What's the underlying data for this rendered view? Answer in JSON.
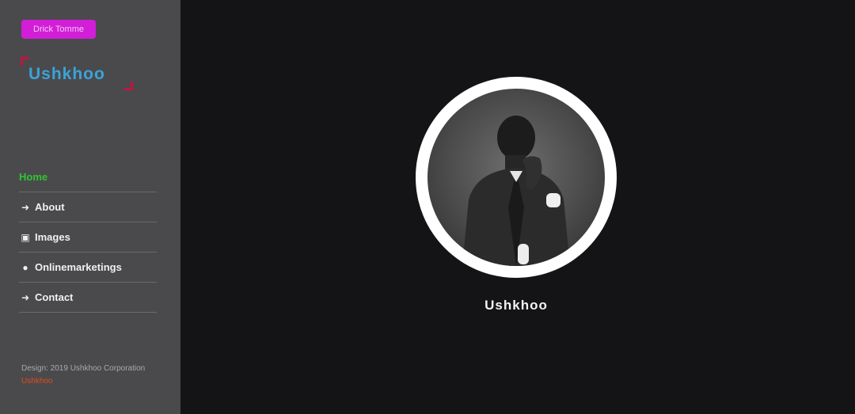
{
  "sidebar": {
    "badge_label": "Drick Tomme",
    "logo_text": "Ushkhoo",
    "nav_items": [
      {
        "label": "Home",
        "icon": "home-icon",
        "glyph": "",
        "active": true
      },
      {
        "label": "About",
        "icon": "arrow-right-icon",
        "glyph": "➜",
        "active": false
      },
      {
        "label": "Images",
        "icon": "image-icon",
        "glyph": "▣",
        "active": false
      },
      {
        "label": "Onlinemarketings",
        "icon": "chat-bubble-icon",
        "glyph": "●",
        "active": false
      },
      {
        "label": "Contact",
        "icon": "arrow-right-icon",
        "glyph": "➜",
        "active": false
      }
    ],
    "footer": {
      "copyright": "Design: 2019 Ushkhoo Corporation",
      "link_label": "Ushkhoo"
    }
  },
  "main": {
    "profile_name": "Ushkhoo"
  },
  "colors": {
    "sidebar_bg": "#4a4a4d",
    "main_bg": "#141417",
    "badge": "#d21ed6",
    "logo": "#3aa4d8",
    "logo_mark": "#c4143c",
    "nav_active": "#2fc52f",
    "footer_link": "#e04c1e"
  }
}
